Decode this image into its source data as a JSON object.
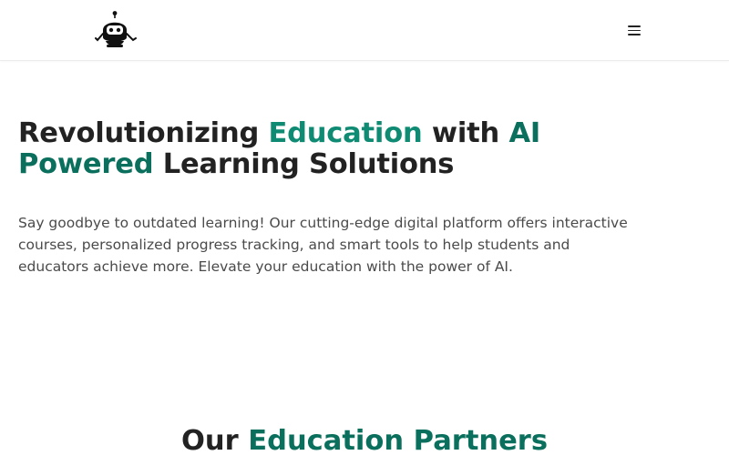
{
  "header": {
    "logo_icon": "robot-mascot-icon",
    "menu_icon": "hamburger-menu-icon"
  },
  "hero": {
    "title_part1": "Revolutionizing ",
    "title_accent1": "Education",
    "title_part2": " with ",
    "title_accent2": "AI Powered",
    "title_part3": " Learning Solutions",
    "description": "Say goodbye to outdated learning! Our cutting-edge digital platform offers interactive courses, personalized progress tracking, and smart tools to help students and educators achieve more. Elevate your education with the power of AI."
  },
  "partners": {
    "title_part1": "Our ",
    "title_accent": "Education Partners"
  },
  "colors": {
    "accent": "#0e8b72",
    "accent_dark": "#0b6f5d",
    "text": "#222222",
    "body_text": "#4a4a4a"
  }
}
